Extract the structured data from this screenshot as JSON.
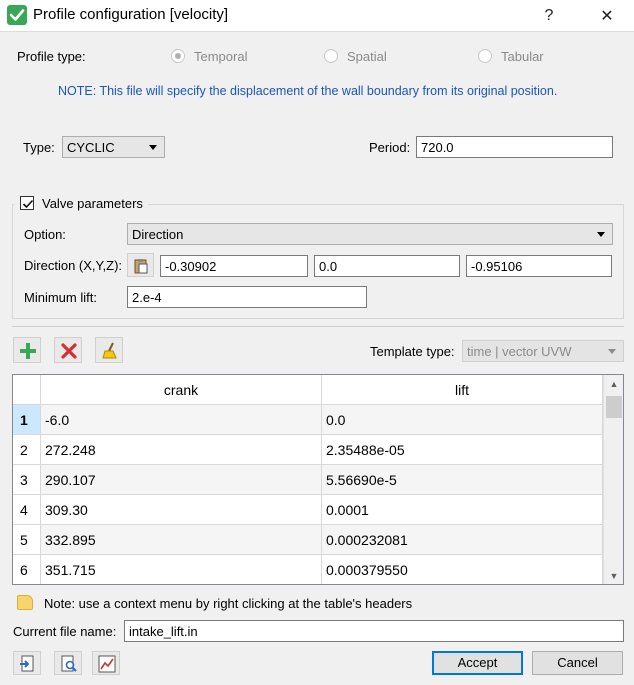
{
  "window": {
    "title": "Profile configuration [velocity]",
    "help_glyph": "?",
    "close_glyph": "✕"
  },
  "profile_type": {
    "label": "Profile type:",
    "options": [
      {
        "label": "Temporal",
        "selected": true
      },
      {
        "label": "Spatial",
        "selected": false
      },
      {
        "label": "Tabular",
        "selected": false
      }
    ]
  },
  "note": "NOTE: This file will specify the displacement of the wall boundary from its original position.",
  "type": {
    "label": "Type:",
    "value": "CYCLIC"
  },
  "period": {
    "label": "Period:",
    "value": "720.0"
  },
  "valve": {
    "checkbox_label": "Valve parameters",
    "checked": true,
    "option_label": "Option:",
    "option_value": "Direction",
    "direction_label": "Direction (X,Y,Z):",
    "direction": [
      "-0.30902",
      "0.0",
      "-0.95106"
    ],
    "min_lift_label": "Minimum lift:",
    "min_lift": "2.e-4"
  },
  "template": {
    "label": "Template type:",
    "value": "time | vector UVW"
  },
  "table": {
    "columns": [
      "crank",
      "lift"
    ],
    "rows": [
      {
        "n": "1",
        "crank": "-6.0",
        "lift": "0.0"
      },
      {
        "n": "2",
        "crank": "272.248",
        "lift": "2.35488e-05"
      },
      {
        "n": "3",
        "crank": "290.107",
        "lift": "5.56690e-5"
      },
      {
        "n": "4",
        "crank": "309.30",
        "lift": "0.0001"
      },
      {
        "n": "5",
        "crank": "332.895",
        "lift": "0.000232081"
      },
      {
        "n": "6",
        "crank": "351.715",
        "lift": "0.000379550"
      }
    ]
  },
  "hint": "Note: use a context menu by right clicking at the table's headers",
  "file": {
    "label": "Current file name:",
    "value": "intake_lift.in"
  },
  "buttons": {
    "accept": "Accept",
    "cancel": "Cancel"
  },
  "colors": {
    "accent": "#0078d7",
    "add_green": "#3aa757",
    "delete_red": "#d32f2f",
    "note_blue": "#1a56b8"
  }
}
